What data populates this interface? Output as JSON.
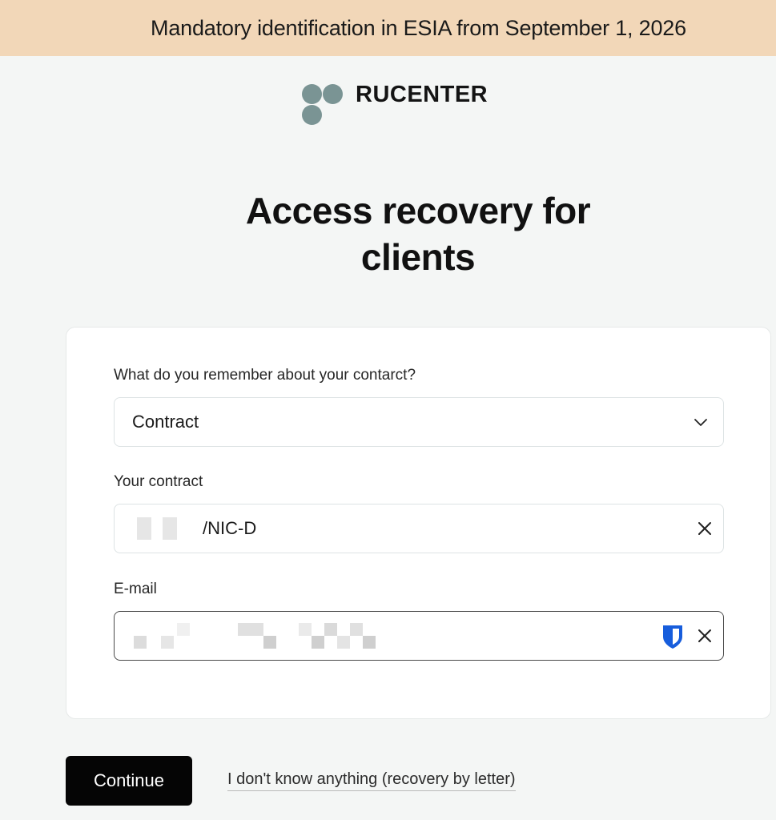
{
  "banner": {
    "text": "Mandatory identification in ESIA from September 1, 2026"
  },
  "logo": {
    "text": "RUCENTER"
  },
  "page": {
    "title_line1": "Access recovery for",
    "title_line2": "clients"
  },
  "form": {
    "remember_label": "What do you remember about your contarct?",
    "remember_value": "Contract",
    "contract_label": "Your contract",
    "contract_value_suffix": "/NIC-D",
    "email_label": "E-mail"
  },
  "actions": {
    "continue_label": "Continue",
    "letter_link": "I don't know anything (recovery by letter)"
  },
  "colors": {
    "banner_bg": "#f2d7b8",
    "logo_mark": "#7a9494",
    "button_bg": "#050505",
    "password_manager_icon": "#175ddc"
  }
}
